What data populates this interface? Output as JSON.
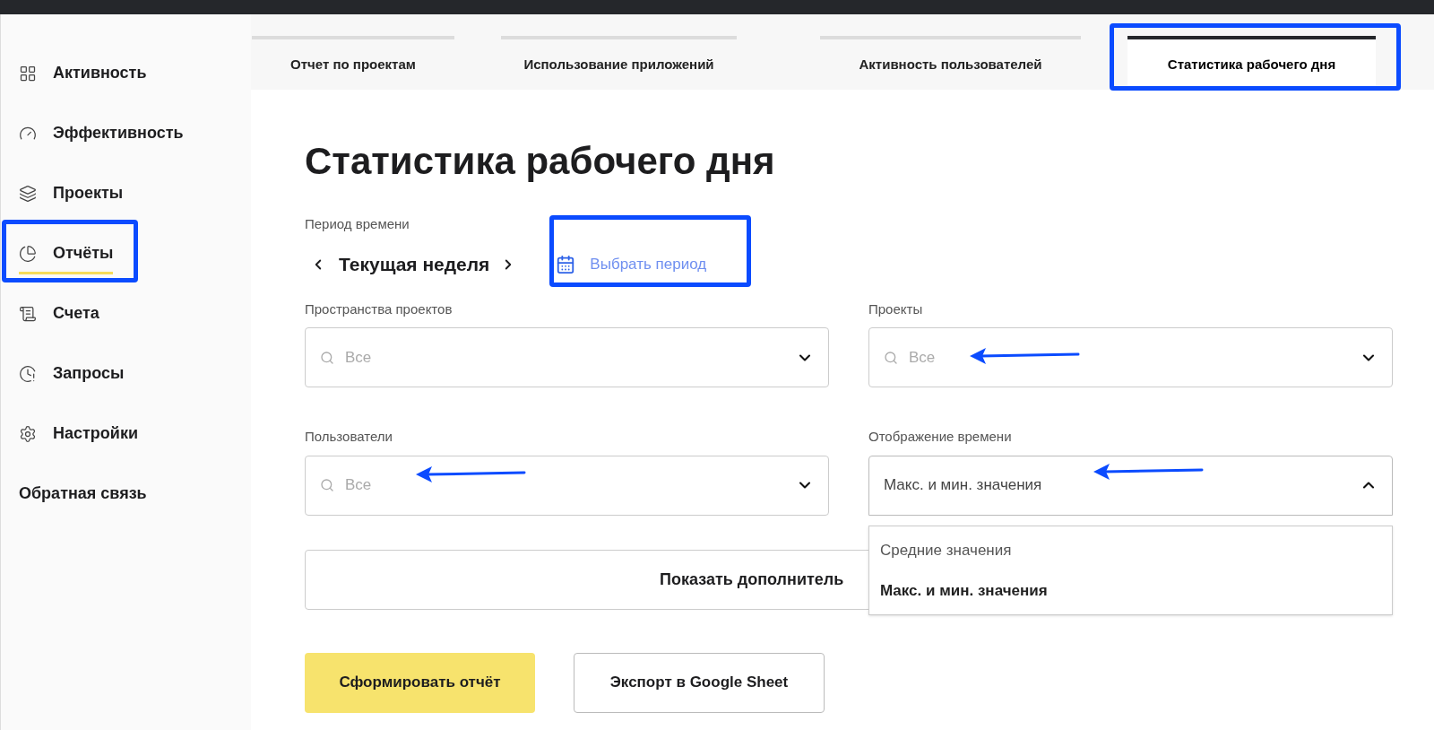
{
  "sidebar": {
    "items": [
      {
        "label": "Активность",
        "kind": "grid",
        "selected": false
      },
      {
        "label": "Эффективность",
        "kind": "gauge",
        "selected": false
      },
      {
        "label": "Проекты",
        "kind": "layers",
        "selected": false
      },
      {
        "label": "Отчёты",
        "kind": "pie",
        "selected": true
      },
      {
        "label": "Счета",
        "kind": "receipt",
        "selected": false
      },
      {
        "label": "Запросы",
        "kind": "alert",
        "selected": false
      },
      {
        "label": "Настройки",
        "kind": "gear",
        "selected": false
      }
    ],
    "feedback": "Обратная связь"
  },
  "tabs": [
    {
      "label": "Отчет по проектам",
      "selected": false
    },
    {
      "label": "Использование приложений",
      "selected": false
    },
    {
      "label": "Активность пользователей",
      "selected": false
    },
    {
      "label": "Статистика рабочего дня",
      "selected": true
    }
  ],
  "title": "Статистика рабочего дня",
  "period": {
    "label": "Период времени",
    "value": "Текущая неделя",
    "pick": "Выбрать период"
  },
  "filters": [
    {
      "label": "Пространства проектов",
      "placeholder": "Все",
      "kind": "search",
      "expanded": false
    },
    {
      "label": "Проекты",
      "placeholder": "Все",
      "kind": "search",
      "expanded": false
    },
    {
      "label": "Пользователи",
      "placeholder": "Все",
      "kind": "search",
      "expanded": false
    },
    {
      "label": "Отображение времени",
      "value": "Макс. и мин. значения",
      "kind": "select",
      "expanded": true,
      "options": [
        {
          "label": "Средние значения",
          "selected": false
        },
        {
          "label": "Макс. и мин. значения",
          "selected": true
        }
      ]
    }
  ],
  "more_button": "Показать дополнитель",
  "buttons": [
    {
      "label": "Сформировать отчёт",
      "kind": "primary"
    },
    {
      "label": "Экспорт в Google Sheet",
      "kind": "secondary"
    }
  ]
}
